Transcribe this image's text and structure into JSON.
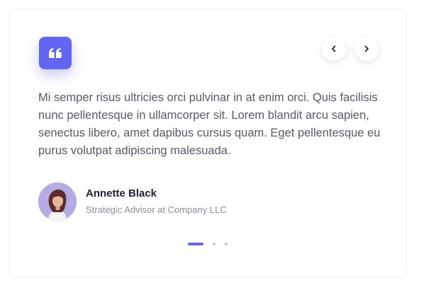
{
  "testimonial": {
    "quote": "Mi semper risus ultricies orci pulvinar in at enim orci. Quis facilisis nunc pellentesque in ullamcorper sit. Lorem blandit arcu sapien, senectus libero, amet dapibus cursus quam. Eget pellentesque eu purus volutpat adipiscing malesuada.",
    "author_name": "Annette Black",
    "author_title": "Strategic Advisor at Company LLC"
  },
  "icons": {
    "quote": "quote-icon",
    "prev": "chevron-left-icon",
    "next": "chevron-right-icon"
  },
  "pagination": {
    "total": 3,
    "active": 1
  },
  "colors": {
    "accent": "#6366f1",
    "text": "#565b66",
    "name": "#1e2130",
    "muted": "#8a8f9a",
    "dot_inactive": "#c4c7cf"
  }
}
